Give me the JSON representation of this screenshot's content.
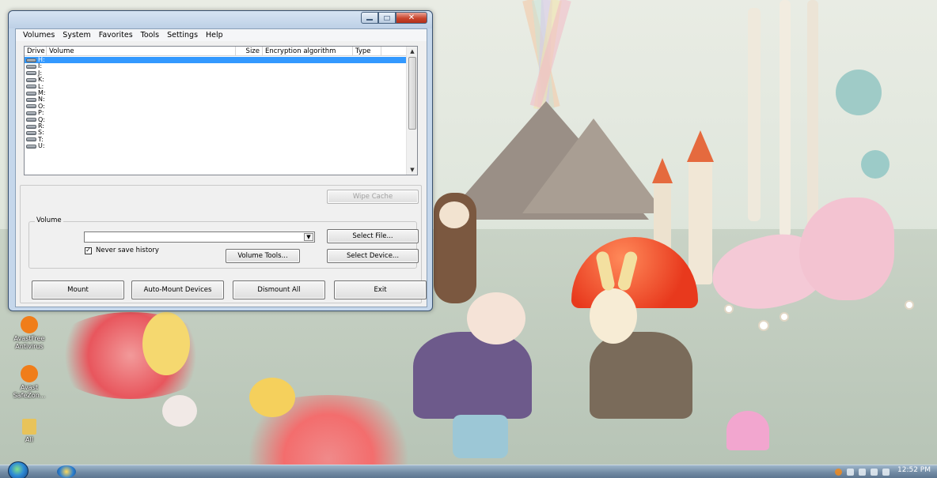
{
  "window": {
    "menu": [
      "Volumes",
      "System",
      "Favorites",
      "Tools",
      "Settings",
      "Help"
    ],
    "drive_list": {
      "columns": [
        "Drive",
        "Volume",
        "Size",
        "Encryption algorithm",
        "Type"
      ],
      "rows": [
        "H:",
        "I:",
        "J:",
        "K:",
        "L:",
        "M:",
        "N:",
        "O:",
        "P:",
        "Q:",
        "R:",
        "S:",
        "T:",
        "U:"
      ],
      "selected_row": "H:"
    },
    "buttons": {
      "wipe_cache": "Wipe Cache",
      "select_file": "Select File...",
      "volume_tools": "Volume Tools...",
      "select_device": "Select Device...",
      "mount": "Mount",
      "auto_mount": "Auto-Mount Devices",
      "dismount_all": "Dismount All",
      "exit": "Exit"
    },
    "volume_group_label": "Volume",
    "volume_path": "",
    "never_save_history": {
      "label": "Never save history",
      "checked": true,
      "mark": "✓"
    }
  },
  "desktop": {
    "icons": [
      {
        "label": "AvastFree Antivirus",
        "icon": "avast-icon",
        "color": "#f07d1a"
      },
      {
        "label": "Avast SafeZon...",
        "icon": "avast-safezone-icon",
        "color": "#f07d1a"
      },
      {
        "label": "All",
        "icon": "folder-icon",
        "color": "#e8c35a"
      }
    ]
  },
  "taskbar": {
    "clock": "12:52 PM"
  }
}
